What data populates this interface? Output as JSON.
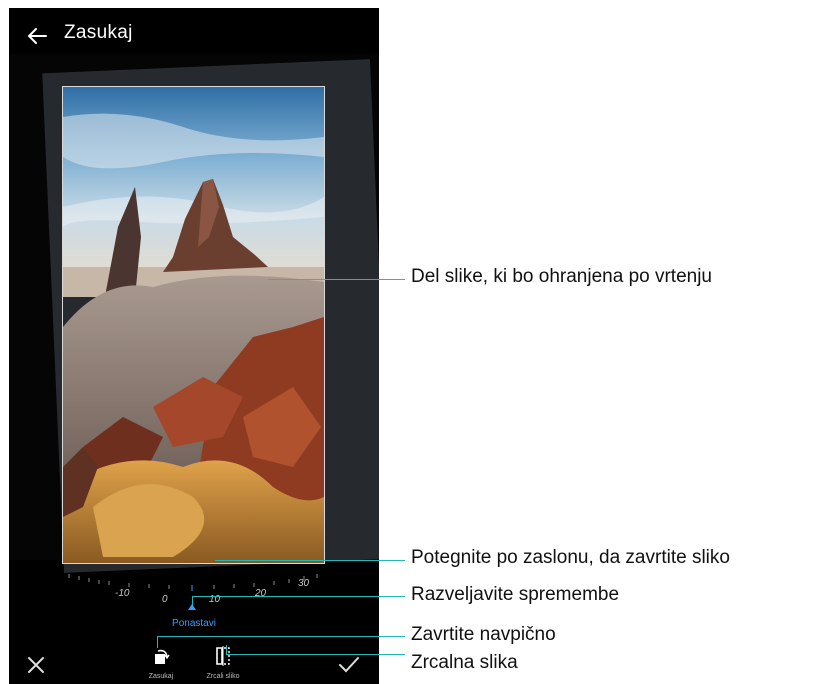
{
  "header": {
    "title": "Zasukaj"
  },
  "dial": {
    "ticks": [
      "-10",
      "0",
      "10",
      "20",
      "30"
    ]
  },
  "reset_label": "Ponastavi",
  "toolbar": {
    "rotate_label": "Zasukaj",
    "mirror_label": "Zrcali sliko"
  },
  "callouts": {
    "keep_area": "Del slike, ki bo ohranjena po vrtenju",
    "drag_rotate": "Potegnite po zaslonu, da zavrtite sliko",
    "undo": "Razveljavite spremembe",
    "rotate_vertical": "Zavrtite navpično",
    "mirror": "Zrcalna slika"
  },
  "colors": {
    "accent": "#3a9cff",
    "callout": "#25b8b8"
  }
}
